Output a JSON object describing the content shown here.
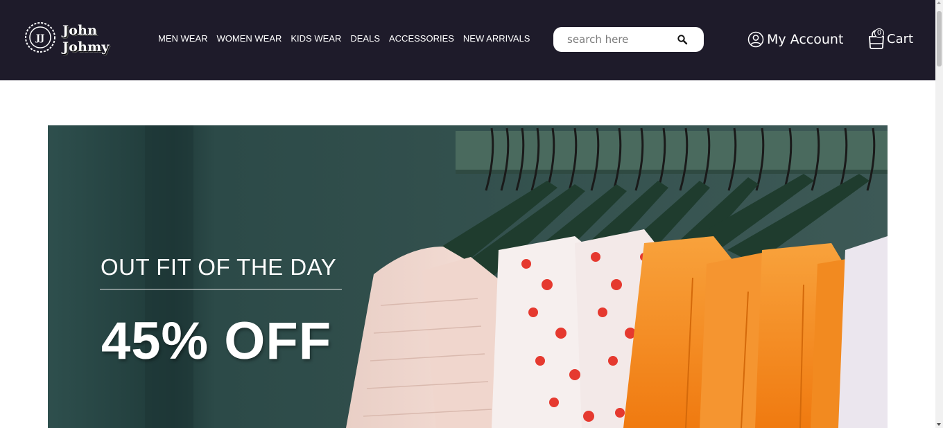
{
  "brand": {
    "line1": "John",
    "line2": "Johmy",
    "emblem": "JJ"
  },
  "nav": {
    "items": [
      {
        "label": "MEN WEAR"
      },
      {
        "label": "WOMEN WEAR"
      },
      {
        "label": "KIDS WEAR"
      },
      {
        "label": "DEALS"
      },
      {
        "label": "ACCESSORIES"
      },
      {
        "label": "NEW ARRIVALS"
      }
    ]
  },
  "search": {
    "placeholder": "search here",
    "icon": "search-icon"
  },
  "account": {
    "label": "My Account",
    "icon": "user-circle-icon"
  },
  "cart": {
    "label": "Cart",
    "count": "0",
    "icon": "shopping-bag-icon"
  },
  "hero": {
    "subtitle": "OUT FIT OF THE DAY",
    "title": "45% OFF"
  },
  "colors": {
    "header_bg": "#1e1b2a",
    "hero_bg": "#2c4a48",
    "accent_orange": "#f58a1f"
  }
}
